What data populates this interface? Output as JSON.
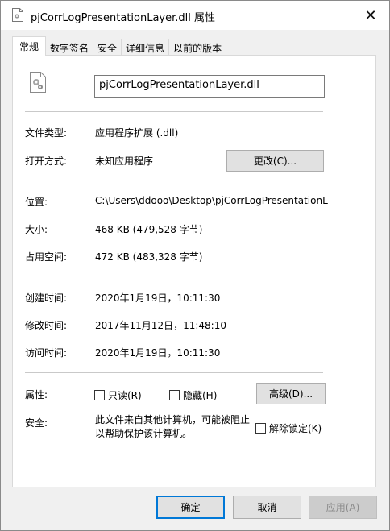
{
  "window": {
    "title": "pjCorrLogPresentationLayer.dll 属性",
    "close_glyph": "✕"
  },
  "tabs": [
    {
      "label": "常规",
      "active": true
    },
    {
      "label": "数字签名",
      "active": false
    },
    {
      "label": "安全",
      "active": false
    },
    {
      "label": "详细信息",
      "active": false
    },
    {
      "label": "以前的版本",
      "active": false
    }
  ],
  "general": {
    "file_name": "pjCorrLogPresentationLayer.dll",
    "file_type_label": "文件类型:",
    "file_type_value": "应用程序扩展 (.dll)",
    "open_with_label": "打开方式:",
    "open_with_value": "未知应用程序",
    "change_button": "更改(C)...",
    "location_label": "位置:",
    "location_value": "C:\\Users\\ddooo\\Desktop\\pjCorrLogPresentationLayer",
    "size_label": "大小:",
    "size_value": "468 KB (479,528 字节)",
    "size_on_disk_label": "占用空间:",
    "size_on_disk_value": "472 KB (483,328 字节)",
    "created_label": "创建时间:",
    "created_value": "2020年1月19日，10:11:30",
    "modified_label": "修改时间:",
    "modified_value": "2017年11月12日，11:48:10",
    "accessed_label": "访问时间:",
    "accessed_value": "2020年1月19日，10:11:30",
    "attributes_label": "属性:",
    "readonly_label": "只读(R)",
    "hidden_label": "隐藏(H)",
    "advanced_button": "高级(D)...",
    "security_label": "安全:",
    "security_text": "此文件来自其他计算机，可能被阻止以帮助保护该计算机。",
    "unblock_label": "解除锁定(K)"
  },
  "footer": {
    "ok": "确定",
    "cancel": "取消",
    "apply": "应用(A)"
  },
  "colors": {
    "accent": "#0078d7",
    "dialog_bg": "#f0f0f0",
    "panel_bg": "#ffffff"
  }
}
